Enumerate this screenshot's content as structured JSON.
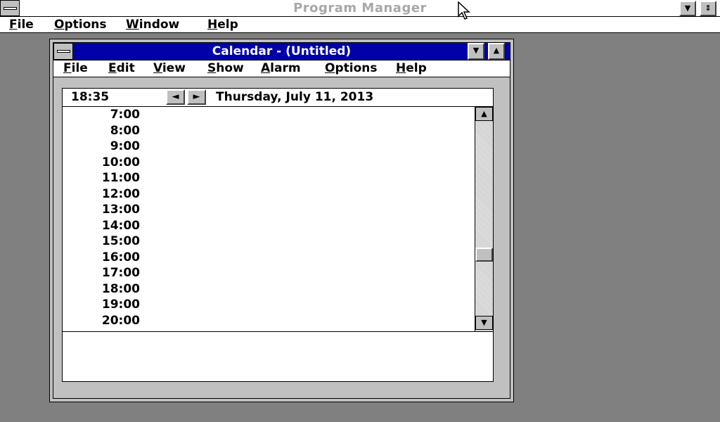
{
  "program_manager": {
    "title": "Program Manager",
    "menu": [
      {
        "label": "File",
        "mnemonic": "F",
        "rest": "ile"
      },
      {
        "label": "Options",
        "mnemonic": "O",
        "rest": "ptions"
      },
      {
        "label": "Window",
        "mnemonic": "W",
        "rest": "indow"
      },
      {
        "label": "Help",
        "mnemonic": "H",
        "rest": "elp"
      }
    ],
    "minimize_glyph": "▼",
    "restore_glyph": "⇕"
  },
  "calendar": {
    "title": "Calendar - (Untitled)",
    "menu": [
      {
        "label": "File",
        "mnemonic": "F",
        "rest": "ile"
      },
      {
        "label": "Edit",
        "mnemonic": "E",
        "rest": "dit"
      },
      {
        "label": "View",
        "mnemonic": "V",
        "rest": "iew"
      },
      {
        "label": "Show",
        "mnemonic": "S",
        "rest": "how"
      },
      {
        "label": "Alarm",
        "mnemonic": "A",
        "rest": "larm"
      },
      {
        "label": "Options",
        "mnemonic": "O",
        "rest": "ptions"
      },
      {
        "label": "Help",
        "mnemonic": "H",
        "rest": "elp"
      }
    ],
    "current_time": "18:35",
    "date": "Thursday, July 11, 2013",
    "prev_glyph": "◄",
    "next_glyph": "►",
    "minimize_glyph": "▼",
    "maximize_glyph": "▲",
    "scroll_up_glyph": "▲",
    "scroll_down_glyph": "▼",
    "time_slots": [
      "7:00",
      "8:00",
      "9:00",
      "10:00",
      "11:00",
      "12:00",
      "13:00",
      "14:00",
      "15:00",
      "16:00",
      "17:00",
      "18:00",
      "19:00",
      "20:00"
    ],
    "notes": ""
  },
  "colors": {
    "desktop": "#808080",
    "active_title": "#0000a8",
    "window_face": "#c0c0c0"
  },
  "icons": [
    "system-menu-icon",
    "minimize-icon",
    "restore-icon",
    "maximize-icon",
    "arrow-left-icon",
    "arrow-right-icon",
    "scroll-up-icon",
    "scroll-down-icon",
    "mouse-cursor-icon"
  ]
}
